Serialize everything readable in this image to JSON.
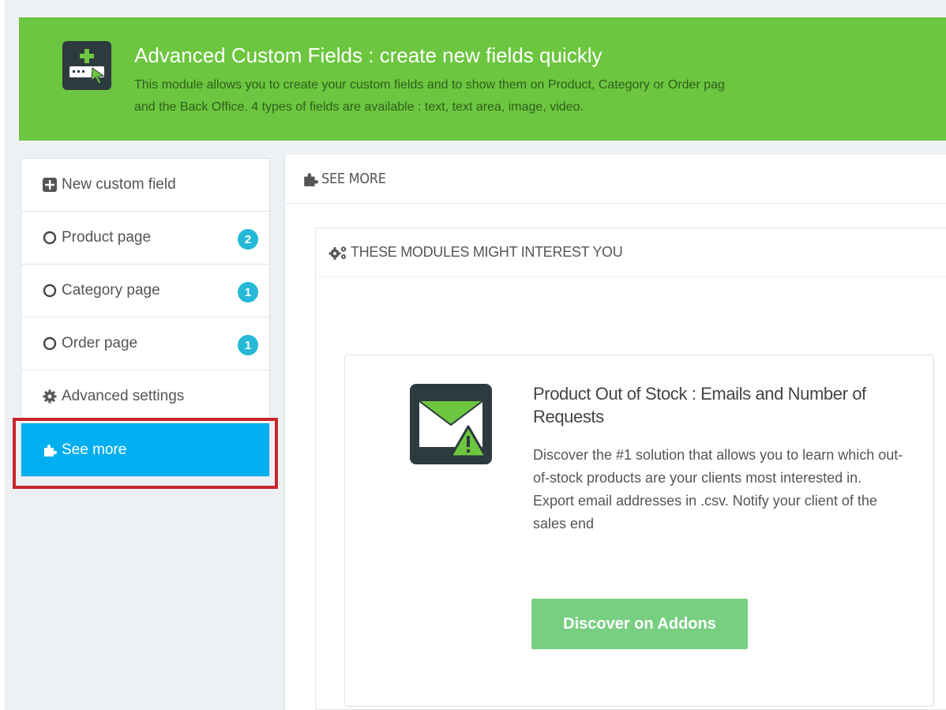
{
  "colors": {
    "accent": "#6cc63f",
    "active": "#00aff0",
    "badge": "#25b9d7",
    "highlight": "#c9252c",
    "button": "#78cf81"
  },
  "banner": {
    "icon": "add-field-icon",
    "title": "Advanced Custom Fields : create new fields quickly",
    "description_line1": "This module allows you to create your custom fields and to show them on Product, Category or Order pag",
    "description_line2": "and the Back Office. 4 types of fields are available : text, text area, image, video."
  },
  "sidebar": {
    "items": [
      {
        "label": "New custom field",
        "icon": "plus-square-icon"
      },
      {
        "label": "Product page",
        "icon": "circle-icon",
        "badge": "2"
      },
      {
        "label": "Category page",
        "icon": "circle-icon",
        "badge": "1"
      },
      {
        "label": "Order page",
        "icon": "circle-icon",
        "badge": "1"
      },
      {
        "label": "Advanced settings",
        "icon": "gear-icon"
      },
      {
        "label": "See more",
        "icon": "puzzle-icon",
        "active": true
      }
    ]
  },
  "main": {
    "header": "SEE MORE",
    "header_icon": "puzzle-icon",
    "panel_title": "THESE MODULES MIGHT INTEREST YOU",
    "panel_icon": "gears-icon",
    "module": {
      "icon": "mail-warning-icon",
      "title": "Product Out of Stock : Emails and Number of Requests",
      "description": "Discover the #1 solution that allows you to learn which out-of-stock products are your clients most interested in. Export email addresses in .csv. Notify your client of the sales end",
      "button_label": "Discover on Addons"
    }
  }
}
